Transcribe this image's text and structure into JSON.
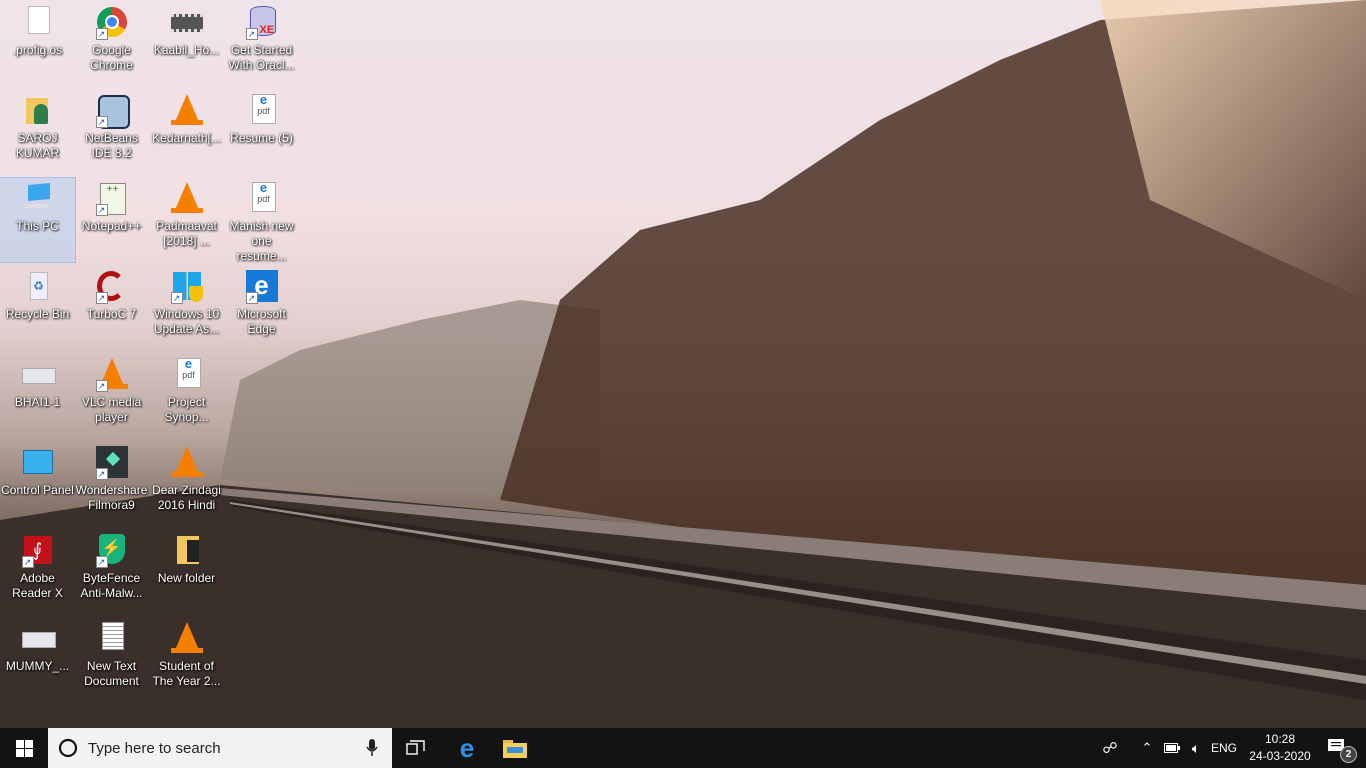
{
  "desktop": {
    "columns": [
      [
        {
          "label": ".profig.os",
          "icon": "file-icon"
        },
        {
          "label": "SAROJ KUMAR",
          "icon": "user-folder-icon"
        },
        {
          "label": "This PC",
          "icon": "computer-icon",
          "selected": true
        },
        {
          "label": "Recycle Bin",
          "icon": "recycle-bin-icon"
        },
        {
          "label": "BHAI1-1",
          "icon": "image-icon"
        },
        {
          "label": "Control Panel",
          "icon": "control-panel-icon"
        },
        {
          "label": "Adobe Reader X",
          "icon": "adobe-reader-icon",
          "shortcut": true
        },
        {
          "label": "MUMMY_...",
          "icon": "image-icon"
        }
      ],
      [
        {
          "label": "Google Chrome",
          "icon": "chrome-icon",
          "shortcut": true
        },
        {
          "label": "NetBeans IDE 8.2",
          "icon": "netbeans-icon",
          "shortcut": true
        },
        {
          "label": "Notepad++",
          "icon": "notepadpp-icon",
          "shortcut": true
        },
        {
          "label": "TurboC 7",
          "icon": "turboc-icon",
          "shortcut": true
        },
        {
          "label": "VLC media player",
          "icon": "vlc-icon",
          "shortcut": true
        },
        {
          "label": "Wondershare Filmora9",
          "icon": "filmora-icon",
          "shortcut": true
        },
        {
          "label": "ByteFence Anti-Malw...",
          "icon": "bytefence-icon",
          "shortcut": true
        },
        {
          "label": "New Text Document",
          "icon": "text-file-icon"
        }
      ],
      [
        {
          "label": "Kaabil_Ho...",
          "icon": "video-file-icon"
        },
        {
          "label": "Kedarnath[...",
          "icon": "vlc-icon"
        },
        {
          "label": "Padmaavat [2018]    ...",
          "icon": "vlc-icon"
        },
        {
          "label": "Windows 10 Update As...",
          "icon": "windows-update-icon",
          "shortcut": true
        },
        {
          "label": "Project Synop...",
          "icon": "pdf-icon"
        },
        {
          "label": "Dear Zindagi 2016 Hindi",
          "icon": "vlc-icon"
        },
        {
          "label": "New folder",
          "icon": "folder-icon"
        },
        {
          "label": "Student of The Year 2...",
          "icon": "vlc-icon"
        }
      ],
      [
        {
          "label": "Get Started With Oracl...",
          "icon": "oracle-db-icon",
          "shortcut": true
        },
        {
          "label": "Resume (5)",
          "icon": "pdf-icon"
        },
        {
          "label": "Manish new one resume...",
          "icon": "pdf-icon"
        },
        {
          "label": "Microsoft Edge",
          "icon": "edge-icon",
          "shortcut": true
        }
      ]
    ]
  },
  "taskbar": {
    "search_placeholder": "Type here to search",
    "language": "ENG",
    "time": "10:28",
    "date": "24-03-2020",
    "notification_count": "2"
  }
}
